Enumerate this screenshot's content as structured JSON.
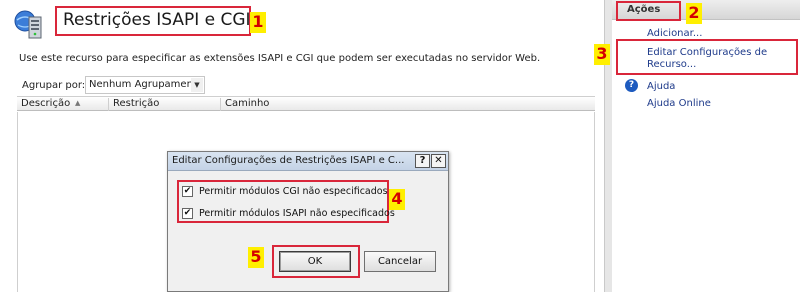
{
  "main": {
    "title": "Restrições ISAPI e CGI",
    "description": "Use este recurso para especificar as extensões ISAPI e CGI que podem ser executadas no servidor Web.",
    "group_by": {
      "label": "Agrupar por:",
      "selected": "Nenhum Agrupamento"
    },
    "grid": {
      "columns": [
        "Descrição",
        "Restrição",
        "Caminho"
      ],
      "rows": []
    }
  },
  "actions": {
    "title": "Ações",
    "items": [
      {
        "label": "Adicionar..."
      },
      {
        "label": "Editar Configurações de Recurso..."
      },
      {
        "label": "Ajuda"
      },
      {
        "label": "Ajuda Online"
      }
    ]
  },
  "dialog": {
    "title": "Editar Configurações de Restrições ISAPI e C...",
    "help_button": "?",
    "close_button": "✕",
    "checkboxes": [
      {
        "label": "Permitir módulos CGI não especificados",
        "checked": true
      },
      {
        "label": "Permitir módulos ISAPI não especificados",
        "checked": true
      }
    ],
    "ok_label": "OK",
    "cancel_label": "Cancelar"
  },
  "markers": [
    "1",
    "2",
    "3",
    "4",
    "5"
  ],
  "colors": {
    "highlight_border": "#d9263a",
    "marker_bg": "#ffef00",
    "marker_text": "#d40000",
    "link": "#1e3a8a"
  },
  "icons": {
    "title_icon": "server-icon",
    "help_icon": "help-icon",
    "sort_icon": "sort-ascending-icon"
  }
}
